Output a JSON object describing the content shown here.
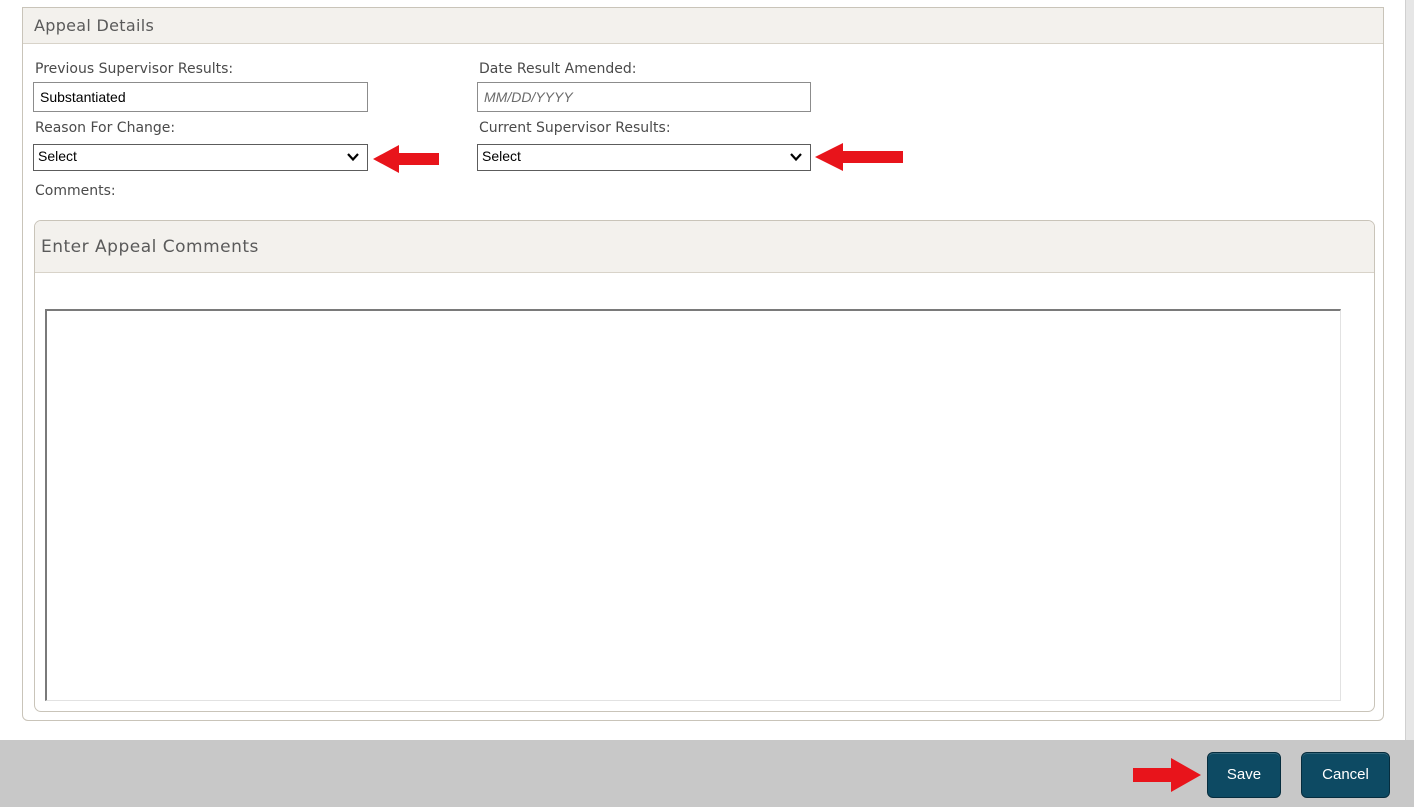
{
  "appeal_details": {
    "title": "Appeal Details",
    "previous_results": {
      "label": "Previous Supervisor Results:",
      "value": "Substantiated"
    },
    "date_amended": {
      "label": "Date Result Amended:",
      "placeholder": "MM/DD/YYYY"
    },
    "reason_for_change": {
      "label": "Reason For Change:",
      "selected": "Select"
    },
    "current_results": {
      "label": "Current Supervisor Results:",
      "selected": "Select"
    },
    "comments_label": "Comments:"
  },
  "comments_panel": {
    "title": "Enter Appeal Comments",
    "value": ""
  },
  "footer": {
    "save_label": "Save",
    "cancel_label": "Cancel"
  },
  "colors": {
    "annotation_arrow": "#e8141b",
    "button_bg": "#0d4a63",
    "footer_bg": "#c8c8c8",
    "panel_header_bg": "#f3f1ed"
  },
  "icons": {
    "dropdown": "chevron-down-icon",
    "annotation": "red-arrow-icon"
  }
}
